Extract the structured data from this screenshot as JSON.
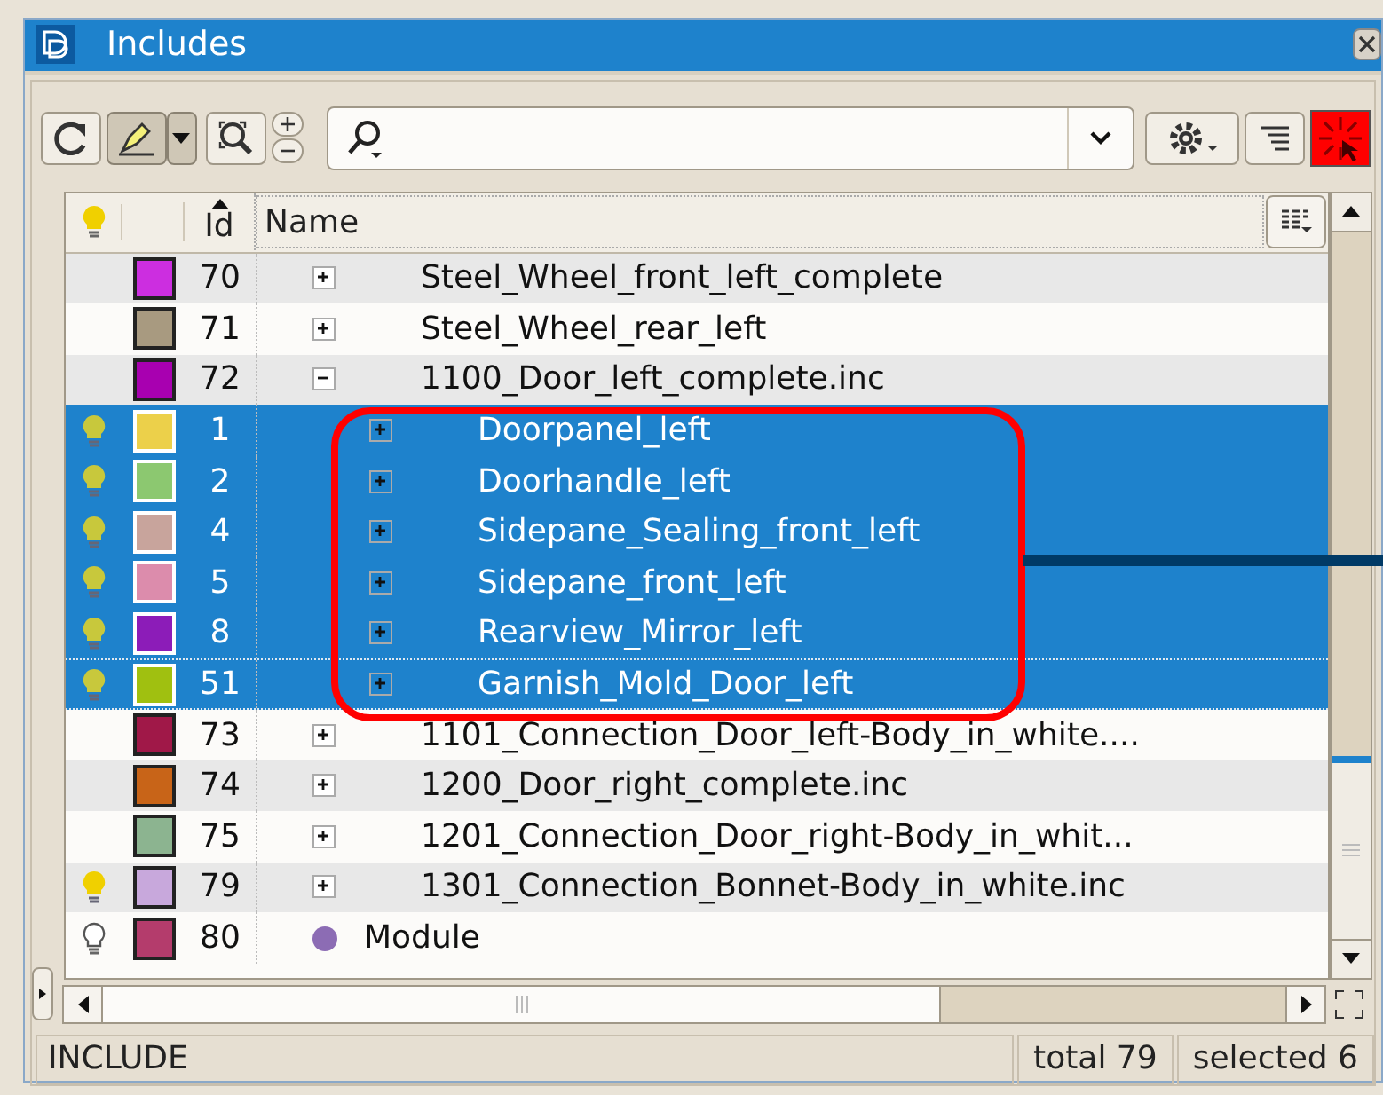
{
  "window": {
    "title": "Includes"
  },
  "table": {
    "columns": [
      {
        "label": "Id",
        "sorted": true
      },
      {
        "label": "Name",
        "sorted": false
      }
    ],
    "rows": [
      {
        "kind": "group",
        "color": "#cc2ee0",
        "id": "70",
        "name": "Steel_Wheel_front_left_complete",
        "expanded": false,
        "selected": false,
        "focused": false
      },
      {
        "kind": "group",
        "color": "#a89a80",
        "id": "71",
        "name": "Steel_Wheel_rear_left",
        "expanded": false,
        "selected": false,
        "focused": false
      },
      {
        "kind": "group",
        "color": "#a800b0",
        "id": "72",
        "name": "1100_Door_left_complete.inc",
        "expanded": true,
        "selected": false,
        "focused": false,
        "children": [
          {
            "kind": "group",
            "lit": true,
            "color": "#ecd04a",
            "id": "1",
            "name": "Doorpanel_left",
            "expanded": false,
            "selected": true,
            "focused": false
          },
          {
            "kind": "group",
            "lit": true,
            "color": "#8cc870",
            "id": "2",
            "name": "Doorhandle_left",
            "expanded": false,
            "selected": true,
            "focused": false
          },
          {
            "kind": "group",
            "lit": true,
            "color": "#c8a49c",
            "id": "4",
            "name": "Sidepane_Sealing_front_left",
            "expanded": false,
            "selected": true,
            "focused": false
          },
          {
            "kind": "group",
            "lit": true,
            "color": "#dc8cac",
            "id": "5",
            "name": "Sidepane_front_left",
            "expanded": false,
            "selected": true,
            "focused": false
          },
          {
            "kind": "group",
            "lit": true,
            "color": "#8c1cb8",
            "id": "8",
            "name": "Rearview_Mirror_left",
            "expanded": false,
            "selected": true,
            "focused": false
          },
          {
            "kind": "group",
            "lit": true,
            "color": "#a0c010",
            "id": "51",
            "name": "Garnish_Mold_Door_left",
            "expanded": false,
            "selected": true,
            "focused": true
          }
        ]
      },
      {
        "kind": "group",
        "color": "#a01848",
        "id": "73",
        "name": "1101_Connection_Door_left-Body_in_white....",
        "expanded": false,
        "selected": false,
        "focused": false
      },
      {
        "kind": "group",
        "color": "#c86418",
        "id": "74",
        "name": "1200_Door_right_complete.inc",
        "expanded": false,
        "selected": false,
        "focused": false
      },
      {
        "kind": "group",
        "color": "#8cb490",
        "id": "75",
        "name": "1201_Connection_Door_right-Body_in_whit...",
        "expanded": false,
        "selected": false,
        "focused": false
      },
      {
        "kind": "group",
        "lit": true,
        "color": "#c8a8dc",
        "id": "79",
        "name": "1301_Connection_Bonnet-Body_in_white.inc",
        "expanded": false,
        "selected": false,
        "focused": false
      },
      {
        "kind": "module",
        "lit": false,
        "color": "#b43c6c",
        "id": "80",
        "name": "Module",
        "selected": false,
        "focused": false
      }
    ]
  },
  "status_bar": {
    "type": "INCLUDE",
    "total": "total 79",
    "selected": "selected 6"
  }
}
